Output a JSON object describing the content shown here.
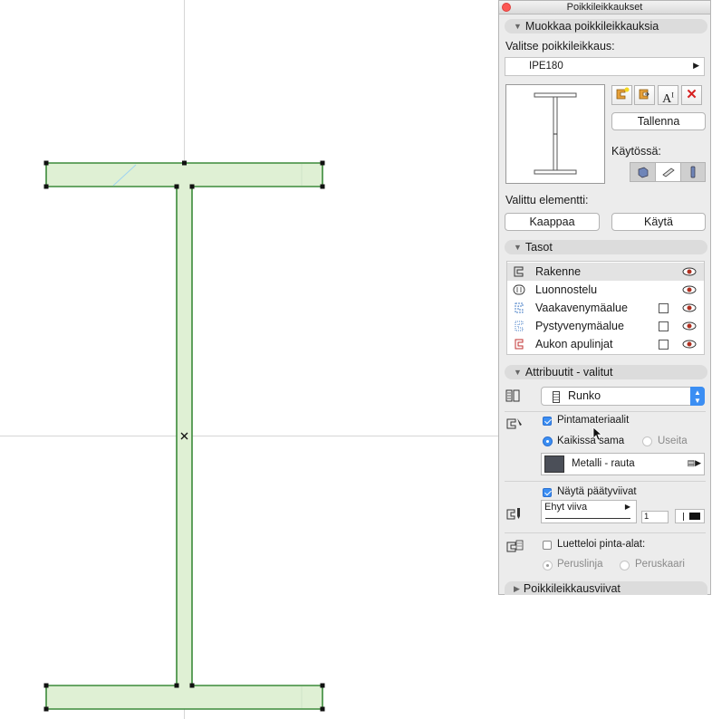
{
  "palette": {
    "title": "Poikkileikkaukset",
    "sections": {
      "edit": "Muokkaa poikkileikkauksia",
      "layers": "Tasot",
      "attributes": "Attribuutit - valitut",
      "lines": "Poikkileikkausviivat"
    },
    "select_label": "Valitse poikkileikkaus:",
    "profile": "IPE180",
    "save_button": "Tallenna",
    "in_use_label": "Käytössä:",
    "selected_element_label": "Valittu elementti:",
    "capture_button": "Kaappaa",
    "apply_button": "Käytä",
    "layers": [
      {
        "name": "Rakenne",
        "checkbox": false
      },
      {
        "name": "Luonnostelu",
        "checkbox": false
      },
      {
        "name": "Vaakavenymäalue",
        "checkbox": true
      },
      {
        "name": "Pystyvenymäalue",
        "checkbox": true
      },
      {
        "name": "Aukon apulinjat",
        "checkbox": true
      }
    ],
    "building_material": "Runko",
    "surface_materials": "Pintamateriaalit",
    "all_same": "Kaikissa sama",
    "multiple": "Useita",
    "surface_name": "Metalli - rauta",
    "surface_color": "#4b4f58",
    "show_end_lines": "Näytä päätyviivat",
    "line_type": "Ehyt viiva",
    "pen_number": "1",
    "list_surfaces": "Luetteloi pinta-alat:",
    "reference_line": "Peruslinja",
    "reference_arc": "Peruskaari"
  },
  "colors": {
    "profile_fill": "#dff0d4",
    "profile_edge": "#3b8a3a",
    "accent": "#3b8ef3"
  }
}
